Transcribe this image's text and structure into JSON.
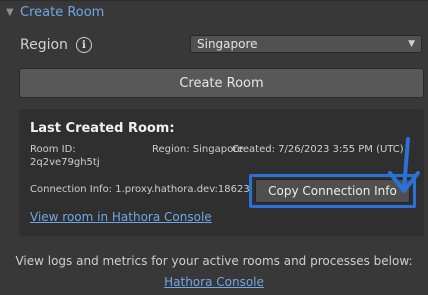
{
  "section": {
    "title": "Create Room",
    "expanded": true
  },
  "region": {
    "label": "Region",
    "info_icon": "info-icon",
    "selected": "Singapore"
  },
  "create_button": {
    "label": "Create Room"
  },
  "last_room": {
    "title": "Last Created Room:",
    "room_id_label": "Room ID:",
    "room_id_value": "2q2ve79gh5tj",
    "region_label": "Region:",
    "region_value": "Singapore",
    "created_label": "Created:",
    "created_value": "7/26/2023 3:55 PM (UTC)",
    "connection_label": "Connection Info:",
    "connection_value": "1.proxy.hathora.dev:18623",
    "copy_button": "Copy Connection Info",
    "view_link": "View room in Hathora Console"
  },
  "footer": {
    "text": "View logs and metrics for your active rooms and processes below:",
    "link": "Hathora Console"
  },
  "colors": {
    "accent": "#2a72d8",
    "link": "#6ea8e8",
    "background": "#383838",
    "panel": "#2f2f2f"
  }
}
